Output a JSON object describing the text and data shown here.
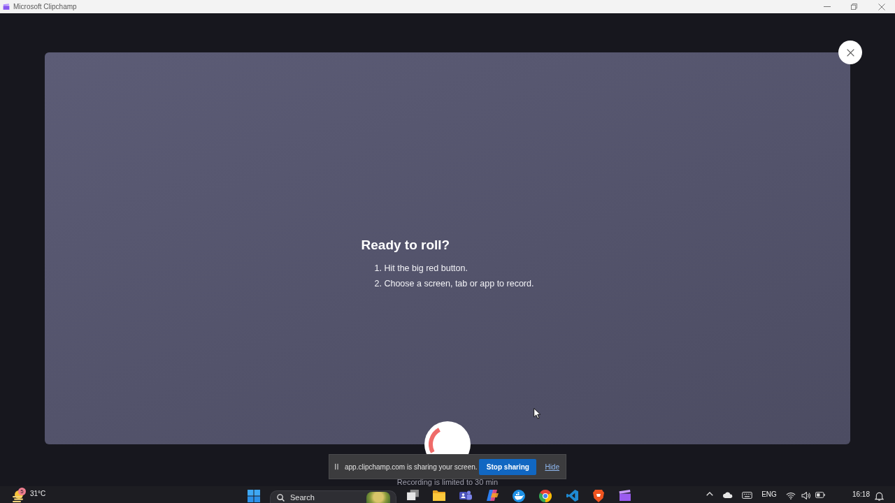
{
  "window": {
    "title": "Microsoft Clipchamp"
  },
  "dialog": {
    "heading": "Ready to roll?",
    "steps": [
      "1. Hit the big red button.",
      "2. Choose a screen, tab or app to record."
    ],
    "note": "Recording is limited to 30 min"
  },
  "sharing_bar": {
    "message": "app.clipchamp.com is sharing your screen.",
    "stop_button": "Stop sharing",
    "hide_link": "Hide"
  },
  "taskbar": {
    "weather": {
      "badge": "5",
      "temperature": "31°C"
    },
    "search": {
      "placeholder": "Search"
    },
    "tray": {
      "language": "ENG",
      "time": "16:18"
    }
  }
}
